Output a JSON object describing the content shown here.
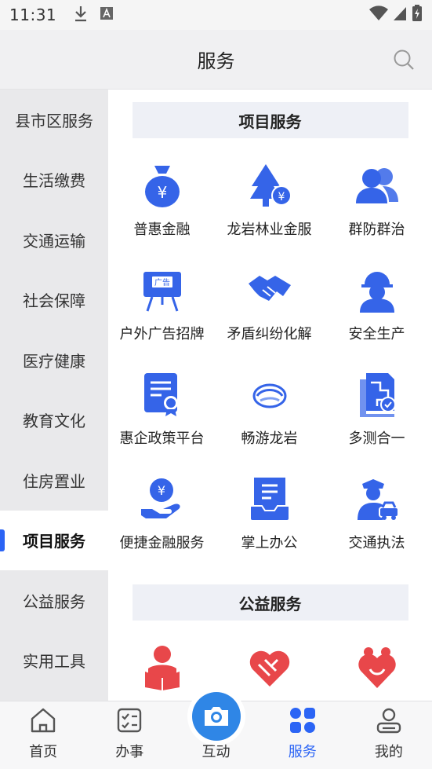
{
  "status_bar": {
    "time": "11:31"
  },
  "header": {
    "title": "服务"
  },
  "sidebar": {
    "items": [
      {
        "label": "县市区服务"
      },
      {
        "label": "生活缴费"
      },
      {
        "label": "交通运输"
      },
      {
        "label": "社会保障"
      },
      {
        "label": "医疗健康"
      },
      {
        "label": "教育文化"
      },
      {
        "label": "住房置业"
      },
      {
        "label": "项目服务",
        "active": true
      },
      {
        "label": "公益服务"
      },
      {
        "label": "实用工具"
      }
    ]
  },
  "sections": [
    {
      "title": "项目服务",
      "items": [
        {
          "label": "普惠金融",
          "icon": "money-bag-icon"
        },
        {
          "label": "龙岩林业金服",
          "icon": "forest-finance-icon"
        },
        {
          "label": "群防群治",
          "icon": "group-people-icon"
        },
        {
          "label": "户外广告招牌",
          "icon": "billboard-icon",
          "badge": "广告"
        },
        {
          "label": "矛盾纠纷化解",
          "icon": "handshake-icon"
        },
        {
          "label": "安全生产",
          "icon": "hardhat-worker-icon"
        },
        {
          "label": "惠企政策平台",
          "icon": "policy-certificate-icon"
        },
        {
          "label": "畅游龙岩",
          "icon": "tourism-logo-icon"
        },
        {
          "label": "多测合一",
          "icon": "survey-map-icon"
        },
        {
          "label": "便捷金融服务",
          "icon": "hand-coin-icon"
        },
        {
          "label": "掌上办公",
          "icon": "office-document-icon"
        },
        {
          "label": "交通执法",
          "icon": "traffic-police-icon"
        }
      ]
    },
    {
      "title": "公益服务",
      "items": [
        {
          "label": "",
          "icon": "reading-person-icon"
        },
        {
          "label": "",
          "icon": "heart-hands-icon"
        },
        {
          "label": "",
          "icon": "heart-family-icon"
        }
      ]
    }
  ],
  "tabbar": {
    "items": [
      {
        "label": "首页",
        "icon": "home-icon"
      },
      {
        "label": "办事",
        "icon": "checklist-icon"
      },
      {
        "label": "互动",
        "icon": "camera-icon"
      },
      {
        "label": "服务",
        "icon": "grid-icon",
        "active": true
      },
      {
        "label": "我的",
        "icon": "user-icon"
      }
    ]
  },
  "colors": {
    "accent": "#2b64f5",
    "icon_blue": "#3564e8",
    "icon_red": "#e8474a",
    "camera": "#2f86e6"
  }
}
